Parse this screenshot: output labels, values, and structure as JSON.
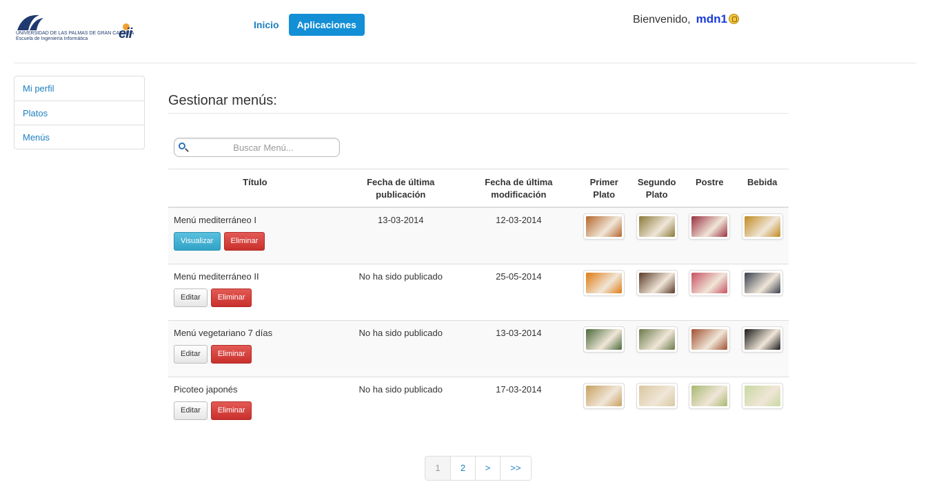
{
  "header": {
    "logo_line1": "UNIVERSIDAD DE LAS PALMAS DE GRAN CANARIA",
    "logo_line2": "Escuela de Ingeniería Informática",
    "logo_mark": "eii",
    "nav": [
      {
        "label": "Inicio",
        "active": false
      },
      {
        "label": "Aplicaciones",
        "active": true
      }
    ],
    "welcome": "Bienvenido,",
    "username": "mdn1"
  },
  "sidebar": {
    "items": [
      {
        "label": "Mi perfil"
      },
      {
        "label": "Platos"
      },
      {
        "label": "Menús"
      }
    ]
  },
  "main": {
    "title": "Gestionar menús:",
    "search_placeholder": "Buscar Menú...",
    "columns": {
      "titulo": "Título",
      "fecha_pub": "Fecha de última publicación",
      "fecha_mod": "Fecha de última modificación",
      "primer": "Primer Plato",
      "segundo": "Segundo Plato",
      "postre": "Postre",
      "bebida": "Bebida"
    },
    "rows": [
      {
        "title": "Menú mediterráneo I",
        "published": "13-03-2014",
        "modified": "12-03-2014",
        "primary_button": "Visualizar",
        "delete_button": "Eliminar",
        "images": {
          "primer": "#b5652a",
          "segundo": "#8a7a3a",
          "postre": "#9a3040",
          "bebida": "#c08a20"
        }
      },
      {
        "title": "Menú mediterráneo II",
        "published": "No ha sido publicado",
        "modified": "25-05-2014",
        "primary_button": "Editar",
        "delete_button": "Eliminar",
        "images": {
          "primer": "#e07a10",
          "segundo": "#5a3a28",
          "postre": "#c85060",
          "bebida": "#3a4050"
        }
      },
      {
        "title": "Menú vegetariano 7 días",
        "published": "No ha sido publicado",
        "modified": "13-03-2014",
        "primary_button": "Editar",
        "delete_button": "Eliminar",
        "images": {
          "primer": "#4a6a3a",
          "segundo": "#6a7a4a",
          "postre": "#a05030",
          "bebida": "#1a1a1a"
        }
      },
      {
        "title": "Picoteo japonés",
        "published": "No ha sido publicado",
        "modified": "17-03-2014",
        "primary_button": "Editar",
        "delete_button": "Eliminar",
        "images": {
          "primer": "#c8a060",
          "segundo": "#d8c8a0",
          "postre": "#a8b870",
          "bebida": "#c8d8a0"
        }
      }
    ]
  },
  "pagination": {
    "pages": [
      "1",
      "2",
      ">",
      ">>"
    ],
    "current": "1"
  },
  "colors": {
    "accent": "#138fd6",
    "link": "#1b7fc0",
    "danger": "#c9302c",
    "info": "#5bc0de",
    "username": "#1a3ad8"
  }
}
